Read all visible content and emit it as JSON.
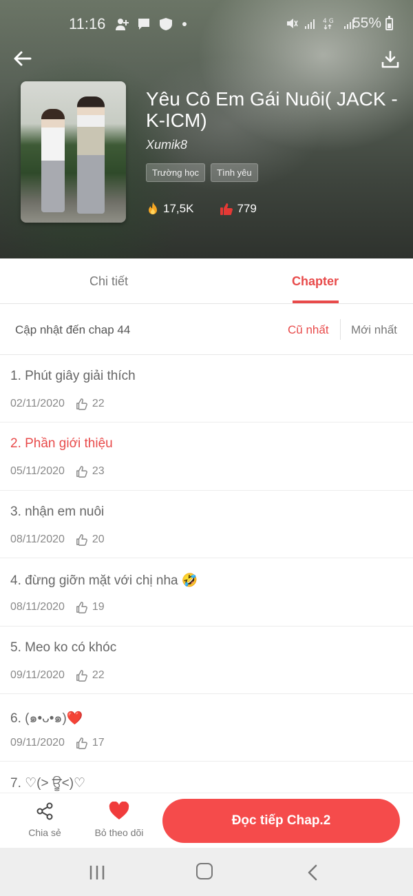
{
  "status_bar": {
    "time": "11:16",
    "battery": "55%",
    "left_icons": [
      "add-person-icon",
      "message-icon",
      "laz-icon",
      "dot-icon"
    ],
    "right_icons": [
      "mute-icon",
      "signal-icon",
      "4g-icon",
      "signal-icon"
    ]
  },
  "book": {
    "title": "Yêu Cô Em Gái Nuôi( JACK - K-ICM)",
    "author": "Xumik8",
    "tags": [
      "Trường học",
      "Tình yêu"
    ],
    "views": "17,5K",
    "likes": "779"
  },
  "tabs": {
    "detail": "Chi tiết",
    "chapter": "Chapter"
  },
  "sort": {
    "update_text": "Cập nhật đến chap 44",
    "oldest": "Cũ nhất",
    "newest": "Mới nhất"
  },
  "chapters": [
    {
      "title": "1. Phút giây giải thích",
      "date": "02/11/2020",
      "likes": "22"
    },
    {
      "title": "2. Phần giới thiệu",
      "date": "05/11/2020",
      "likes": "23"
    },
    {
      "title": "3. nhận em nuôi",
      "date": "08/11/2020",
      "likes": "20"
    },
    {
      "title": "4. đừng giỡn mặt với chị nha 🤣",
      "date": "08/11/2020",
      "likes": "19"
    },
    {
      "title": "5. Meo ko có khóc",
      "date": "09/11/2020",
      "likes": "22"
    },
    {
      "title": "6. (๑•ᴗ•๑)❤️",
      "date": "09/11/2020",
      "likes": "17"
    },
    {
      "title": "7. ♡(> ਊ<)♡",
      "date": "",
      "likes": ""
    }
  ],
  "actions": {
    "share": "Chia sẻ",
    "unfollow": "Bỏ theo dõi",
    "continue_reading": "Đọc tiếp Chap.2"
  },
  "colors": {
    "accent": "#e84a4a",
    "button": "#f54b4b"
  }
}
